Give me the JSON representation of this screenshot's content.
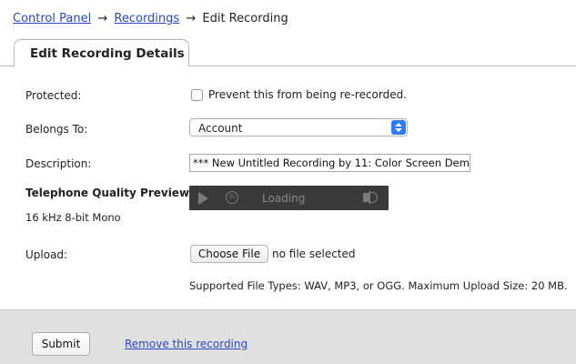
{
  "breadcrumb": {
    "items": [
      "Control Panel",
      "Recordings",
      "Edit Recording"
    ],
    "separator": "→"
  },
  "tab": {
    "label": "Edit Recording Details"
  },
  "form": {
    "protected": {
      "label": "Protected:",
      "checkbox_label": "Prevent this from being re-recorded.",
      "checked": false
    },
    "belongs_to": {
      "label": "Belongs To:",
      "selected": "Account"
    },
    "description": {
      "label": "Description:",
      "value": "*** New Untitled Recording by 11: Color Screen Dem"
    },
    "preview": {
      "label": "Telephone Quality Preview",
      "sublabel": "16 kHz 8-bit Mono",
      "player_status": "Loading",
      "skip_label": "30"
    },
    "upload": {
      "label": "Upload:",
      "button_label": "Choose File",
      "status": "no file selected",
      "hint": "Supported File Types: WAV, MP3, or OGG. Maximum Upload Size: 20 MB."
    }
  },
  "footer": {
    "submit_label": "Submit",
    "remove_label": "Remove this recording"
  },
  "colors": {
    "link": "#2a46c9",
    "select_accent": "#2f7cf2",
    "footer_bg": "#e0e0e0",
    "player_bg": "#3a3a3a"
  }
}
